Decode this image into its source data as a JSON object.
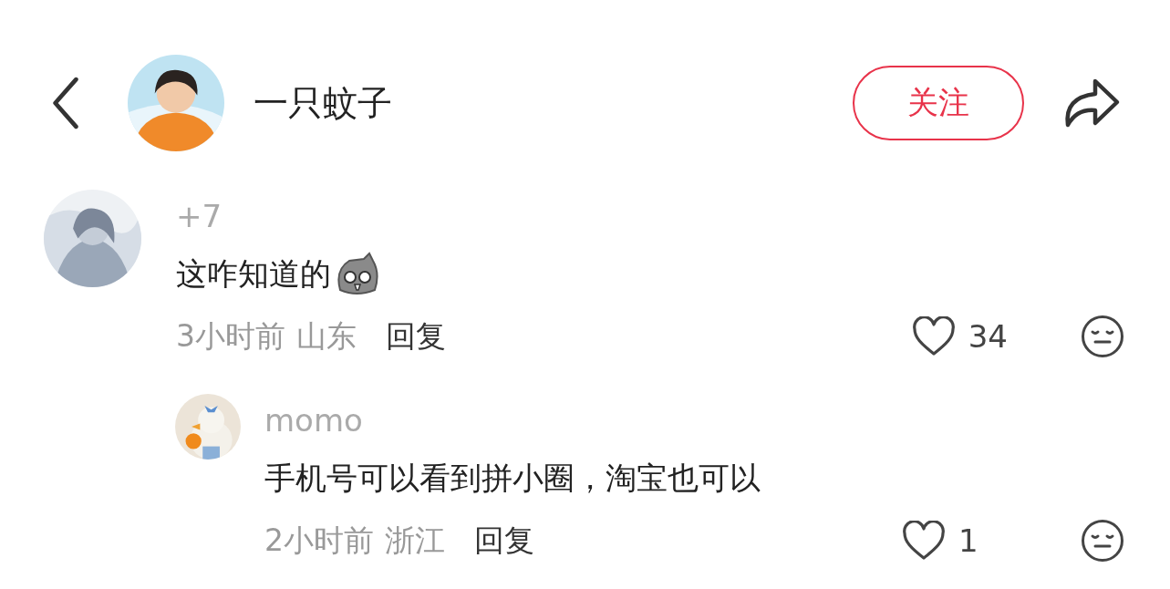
{
  "header": {
    "username": "一只蚊子",
    "follow_button": "关注"
  },
  "comments": [
    {
      "author": "+7",
      "text": "这咋知道的",
      "sticker": true,
      "time": "3小时前",
      "location": "山东",
      "reply_button": "回复",
      "likes": "34",
      "replies": [
        {
          "author": "momo",
          "text": "手机号可以看到拼小圈，淘宝也可以",
          "sticker": false,
          "time": "2小时前",
          "location": "浙江",
          "reply_button": "回复",
          "likes": "1"
        }
      ]
    }
  ]
}
